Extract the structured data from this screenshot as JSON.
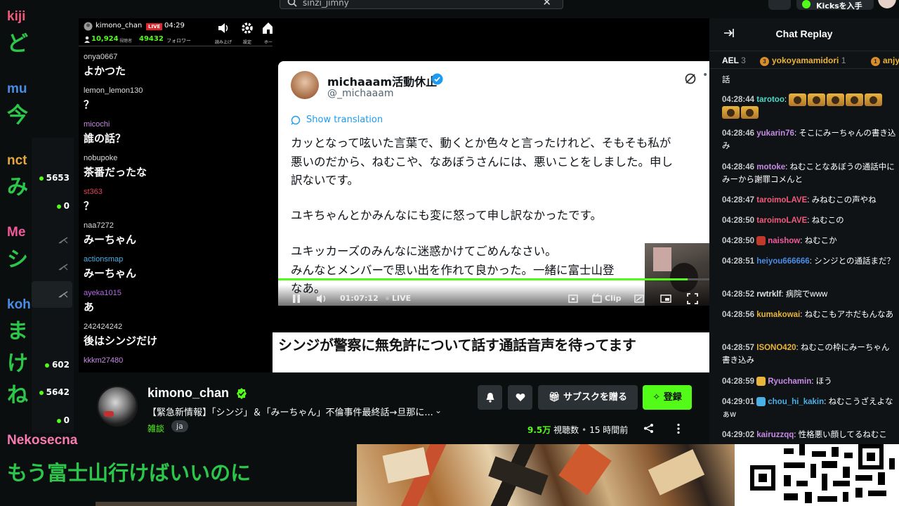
{
  "header": {
    "search_query": "sinzi_jimny",
    "kicks_label": "Kicksを入手"
  },
  "overlay_chat": [
    {
      "user": "kiji",
      "user_color": "#f25a7c",
      "msg": "ど"
    },
    {
      "user": "mu",
      "user_color": "#4a8de6",
      "msg": "今"
    },
    {
      "user": "nct",
      "user_color": "#e8a640",
      "msg": "み"
    },
    {
      "user": "Me",
      "user_color": "#f25a9c",
      "msg": "シ"
    },
    {
      "user": "koh",
      "user_color": "#4a8de6",
      "msg": "ま"
    },
    {
      "user": "",
      "user_color": "#ffffff",
      "msg": "け"
    },
    {
      "user": "",
      "user_color": "#ffffff",
      "msg": "ね"
    }
  ],
  "overlay_bottom": {
    "user": "Nekosecna",
    "msg": "もう富士山行けばいいのに"
  },
  "side_stats": [
    "5653",
    "0",
    "602",
    "5642",
    "0"
  ],
  "phone_chat": {
    "channel": "kimono_chan",
    "live_label": "LIVE",
    "time": "04:29",
    "viewers": "10,924",
    "viewers_label": "視聴者",
    "followers": "49432",
    "followers_label": "フォロワー",
    "icons": [
      {
        "name": "speaker-icon",
        "label": "読み上げ"
      },
      {
        "name": "gear-icon",
        "label": "設定"
      },
      {
        "name": "home-icon",
        "label": "ホー"
      }
    ],
    "messages": [
      {
        "user": "onya0667",
        "color": "#dddddd",
        "text": "よかつた"
      },
      {
        "user": "lemon_lemon130",
        "color": "#dddddd",
        "text": "？"
      },
      {
        "user": "micochi",
        "color": "#c78ae6",
        "text": "誰の話？"
      },
      {
        "user": "nobupoke",
        "color": "#dddddd",
        "text": "茶番だったな"
      },
      {
        "user": "st363",
        "color": "#e0435a",
        "text": "？"
      },
      {
        "user": "naa7272",
        "color": "#dddddd",
        "text": "みーちゃん"
      },
      {
        "user": "actionsmap",
        "color": "#4ab0e6",
        "text": "みーちゃん"
      },
      {
        "user": "ayeka1015",
        "color": "#b06ae6",
        "text": "あ"
      },
      {
        "user": "242424242",
        "color": "#dddddd",
        "text": "後はシンジだけ"
      },
      {
        "user": "kkkm27480",
        "color": "#c78ae6",
        "text": ""
      }
    ]
  },
  "video": {
    "tweet": {
      "name": "michaaam活動休止",
      "handle": "@_michaaam",
      "translate": "Show translation",
      "lines": [
        "カッとなって呟いた言葉で、動くとか色々と言ったけれど、そもそも私が",
        "悪いのだから、ねむこや、なあぼうさんには、悪いことをしました。申し",
        "訳ないです。",
        "",
        "ユキちゃんとかみんなにも変に怒って申し訳なかったです。",
        "",
        "ユキッカーズのみんなに迷惑かけてごめんなさい。",
        "みんなとメンバーで思い出を作れて良かった。一緒に富士山登",
        "なあ。"
      ]
    },
    "player": {
      "time": "01:07:12",
      "live": "LIVE",
      "clip": "Clip",
      "progress": 0.95
    },
    "caption": "シンジが警察に無免許について話す通話音声を待ってます"
  },
  "chat_replay": {
    "title": "Chat Replay",
    "gifters": [
      {
        "name": "AEL",
        "count": "3",
        "color": "#ffffff"
      },
      {
        "name": "yokoyamamidori",
        "count": "1",
        "color": "#e8b43a"
      },
      {
        "name": "anjy",
        "count": "",
        "color": "#e8b43a"
      }
    ],
    "messages": [
      {
        "time": "",
        "user": "",
        "color": "#ffffff",
        "text": "話"
      },
      {
        "time": "04:28:44",
        "user": "tarotoo",
        "color": "#4ad9c4",
        "text": "",
        "emotes": 7
      },
      {
        "time": "04:28:46",
        "user": "yukarin76",
        "color": "#c78ae6",
        "text": "そこにみーちゃんの書き込み"
      },
      {
        "time": "04:28:46",
        "user": "motoke",
        "color": "#c78ae6",
        "text": "ねむことなあぼうの通話中にみーから謝罪コメんと"
      },
      {
        "time": "04:28:47",
        "user": "taroimoLAVE",
        "color": "#f25a7c",
        "text": "みねむこの声やね"
      },
      {
        "time": "04:28:50",
        "user": "taroimoLAVE",
        "color": "#f25a7c",
        "text": "ねむこの"
      },
      {
        "time": "04:28:50",
        "user": "naishow",
        "color": "#f25a9c",
        "text": "ねむこか",
        "badge": "#c0392b"
      },
      {
        "time": "04:28:51",
        "user": "heiyou666666",
        "color": "#4a8de6",
        "text": "シンジとの通話まだ？"
      },
      {
        "time": "04:28:52",
        "user": "rwtrklf",
        "color": "#e0e0e0",
        "text": "病院でwww"
      },
      {
        "time": "04:28:56",
        "user": "kumakowai",
        "color": "#e8b43a",
        "text": "ねむこもアホだもんなあ"
      },
      {
        "time": "04:28:57",
        "user": "ISONO420",
        "color": "#e8b43a",
        "text": "ねむこの枠にみーちゃん書き込み"
      },
      {
        "time": "04:28:59",
        "user": "Ryuchamin",
        "color": "#c78ae6",
        "text": "ほう",
        "badge": "#e8b43a"
      },
      {
        "time": "04:29:01",
        "user": "chou_hi_kakin",
        "color": "#4ab0e6",
        "text": "ねむこうざえよなぁw",
        "badge": "#4ab0e6"
      },
      {
        "time": "04:29:02",
        "user": "kairuzzqq",
        "color": "#c78ae6",
        "text": "性格悪い顔してるねむこ"
      }
    ]
  },
  "channel": {
    "name": "kimono_chan",
    "title": "【緊急新情報】「シンジ」＆「みーちゃん」不倫事件最終話→旦那に...",
    "category": "雑談",
    "language": "ja",
    "views": "9.5万",
    "views_label": "視聴数",
    "age": "15 時間前",
    "subscribe_label": "サブスクを贈る",
    "follow_label": "登録"
  },
  "colors": {
    "accent": "#53fc18",
    "background": "#0b0e0f",
    "panel": "#101315"
  }
}
